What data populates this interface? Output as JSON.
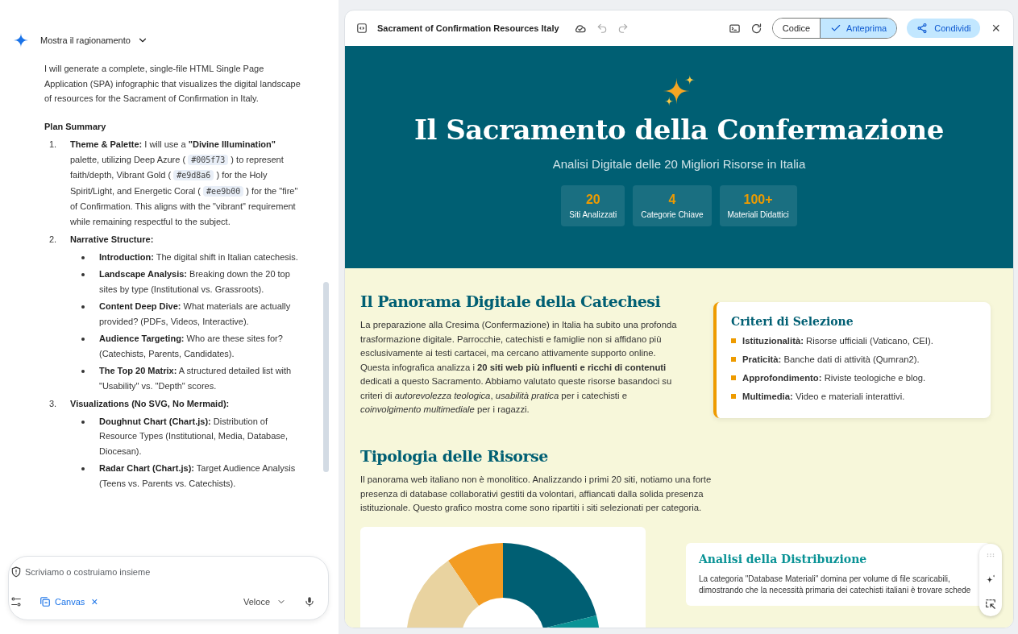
{
  "chat": {
    "reasoning_toggle": "Mostra il ragionamento",
    "intro": "I will generate a complete, single-file HTML Single Page Application (SPA) infographic that visualizes the digital landscape of resources for the Sacrament of Confirmation in Italy.",
    "plan_title": "Plan Summary",
    "plan": [
      {
        "number": "1.",
        "parts": [
          {
            "kind": "text",
            "text": "**Theme & Palette:** I will use a **\"Divine Illumination\"** palette, utilizing Deep Azure ( "
          },
          {
            "kind": "code",
            "text": "#005f73"
          },
          {
            "kind": "text",
            "text": " ) to represent faith/depth, Vibrant Gold ( "
          },
          {
            "kind": "code",
            "text": "#e9d8a6"
          },
          {
            "kind": "text",
            "text": " ) for the Holy Spirit/Light, and Energetic Coral ( "
          },
          {
            "kind": "code",
            "text": "#ee9b00"
          },
          {
            "kind": "text",
            "text": " ) for the \"fire\" of Confirmation. This aligns with the \"vibrant\" requirement while remaining respectful to the subject."
          }
        ]
      },
      {
        "number": "2.",
        "title": "Narrative Structure:",
        "bullets": [
          "**Introduction:** The digital shift in Italian catechesis.",
          "**Landscape Analysis:** Breaking down the 20 top sites by type (Institutional vs. Grassroots).",
          "**Content Deep Dive:** What materials are actually provided? (PDFs, Videos, Interactive).",
          "**Audience Targeting:** Who are these sites for? (Catechists, Parents, Candidates).",
          "**The Top 20 Matrix:** A structured detailed list with \"Usability\" vs. \"Depth\" scores."
        ]
      },
      {
        "number": "3.",
        "title": "Visualizations (No SVG, No Mermaid):",
        "bullets": [
          "**Doughnut Chart (Chart.js):** Distribution of Resource Types (Institutional, Media, Database, Diocesan).",
          "**Radar Chart (Chart.js):** Target Audience Analysis (Teens vs. Parents vs. Catechists)."
        ]
      }
    ]
  },
  "composer": {
    "placeholder": "Scriviamo o costruiamo insieme",
    "tool": "Canvas",
    "tool_close": "×",
    "mode": "Veloce"
  },
  "canvas": {
    "title": "Sacrament of Confirmation Resources Italy",
    "tabs": [
      {
        "label": "Codice",
        "selected": false
      },
      {
        "label": "Anteprima",
        "selected": true
      }
    ],
    "share": "Condividi",
    "close": "×"
  },
  "page": {
    "hero": {
      "title": "Il Sacramento della Confermazione",
      "subtitle": "Analisi Digitale delle 20 Migliori Risorse in Italia",
      "stats": [
        {
          "value": "20",
          "label": "Siti Analizzati"
        },
        {
          "value": "4",
          "label": "Categorie Chiave"
        },
        {
          "value": "100+",
          "label": "Materiali Didattici"
        }
      ]
    },
    "overview": {
      "heading": "Il Panorama Digitale della Catechesi",
      "paragraphs": [
        "La preparazione alla Cresima (Confermazione) in Italia ha subito una profonda trasformazione digitale. Parrocchie, catechisti e famiglie non si affidano più esclusivamente ai testi cartacei, ma cercano attivamente supporto online.",
        "Questa infografica analizza i **20 siti web più influenti e ricchi di contenuti** dedicati a questo Sacramento. Abbiamo valutato queste risorse basandoci su criteri di *autorevolezza teologica*, *usabilità pratica* per i catechisti e *coinvolgimento multimediale* per i ragazzi."
      ],
      "criteria": {
        "heading": "Criteri di Selezione",
        "items": [
          "**Istituzionalità:** Risorse ufficiali (Vaticano, CEI).",
          "**Praticità:** Banche dati di attività (Qumran2).",
          "**Approfondimento:** Riviste teologiche e blog.",
          "**Multimedia:** Video e materiali interattivi."
        ]
      }
    },
    "types": {
      "heading": "Tipologia delle Risorse",
      "paragraph": "Il panorama web italiano non è monolitico. Analizzando i primi 20 siti, notiamo una forte presenza di database collaborativi gestiti da volontari, affiancati dalla solida presenza istituzionale. Questo grafico mostra come sono ripartiti i siti selezionati per categoria.",
      "analysis": {
        "heading": "Analisi della Distribuzione",
        "text": "La categoria \"Database Materiali\" domina per volume di file scaricabili, dimostrando che la necessità primaria dei catechisti italiani è trovare schede"
      }
    }
  }
}
